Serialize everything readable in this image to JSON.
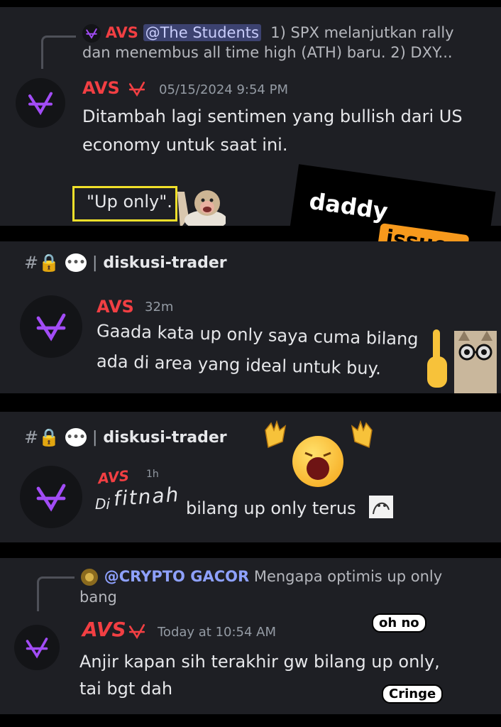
{
  "colors": {
    "panel": "#1e1f24",
    "author_red": "#f23f43",
    "accent_purple": "#a24cf6",
    "timestamp_gray": "#949ba4"
  },
  "panel1": {
    "reply_icon": "avs-logo-icon",
    "reply_name": "AVS",
    "reply_mention": "@The Students",
    "reply_text_line1": "1) SPX melanjutkan rally",
    "reply_text_line2": "dan menembus all time high (ATH) baru.  2) DXY...",
    "author": "AVS",
    "author_badge_icon": "avs-logo-icon",
    "timestamp": "05/15/2024 9:54 PM",
    "message_line1": "Ditambah lagi sentimen yang bullish dari US",
    "message_line2": "economy untuk saat ini.",
    "message_line3": "\"Up only\"."
  },
  "panel2": {
    "channel_name": "diskusi-trader",
    "author": "AVS",
    "timestamp": "32m",
    "message_line1": "Gaada kata up only saya cuma bilang",
    "message_line2": "ada di area yang ideal untuk buy."
  },
  "panel3": {
    "channel_name": "diskusi-trader",
    "author": "AVS",
    "timestamp": "1h",
    "message_word1": "Di",
    "message_word2": "fitnah",
    "message_rest": "bilang up only terus"
  },
  "panel4": {
    "reply_mention": "@CRYPTO GACOR",
    "reply_text_line1": "Mengapa optimis up only",
    "reply_text_line2": "bang",
    "author": "AVS",
    "author_badge_icon": "avs-logo-icon",
    "timestamp": "Today at 10:54 AM",
    "message_line1": "Anjir kapan sih terakhir gw bilang up only,",
    "message_line2": "tai bgt dah"
  },
  "stickers": {
    "daddy_word": "daddy",
    "issues_word": "issues",
    "oh_no": "oh no",
    "cringe": "Cringe"
  }
}
